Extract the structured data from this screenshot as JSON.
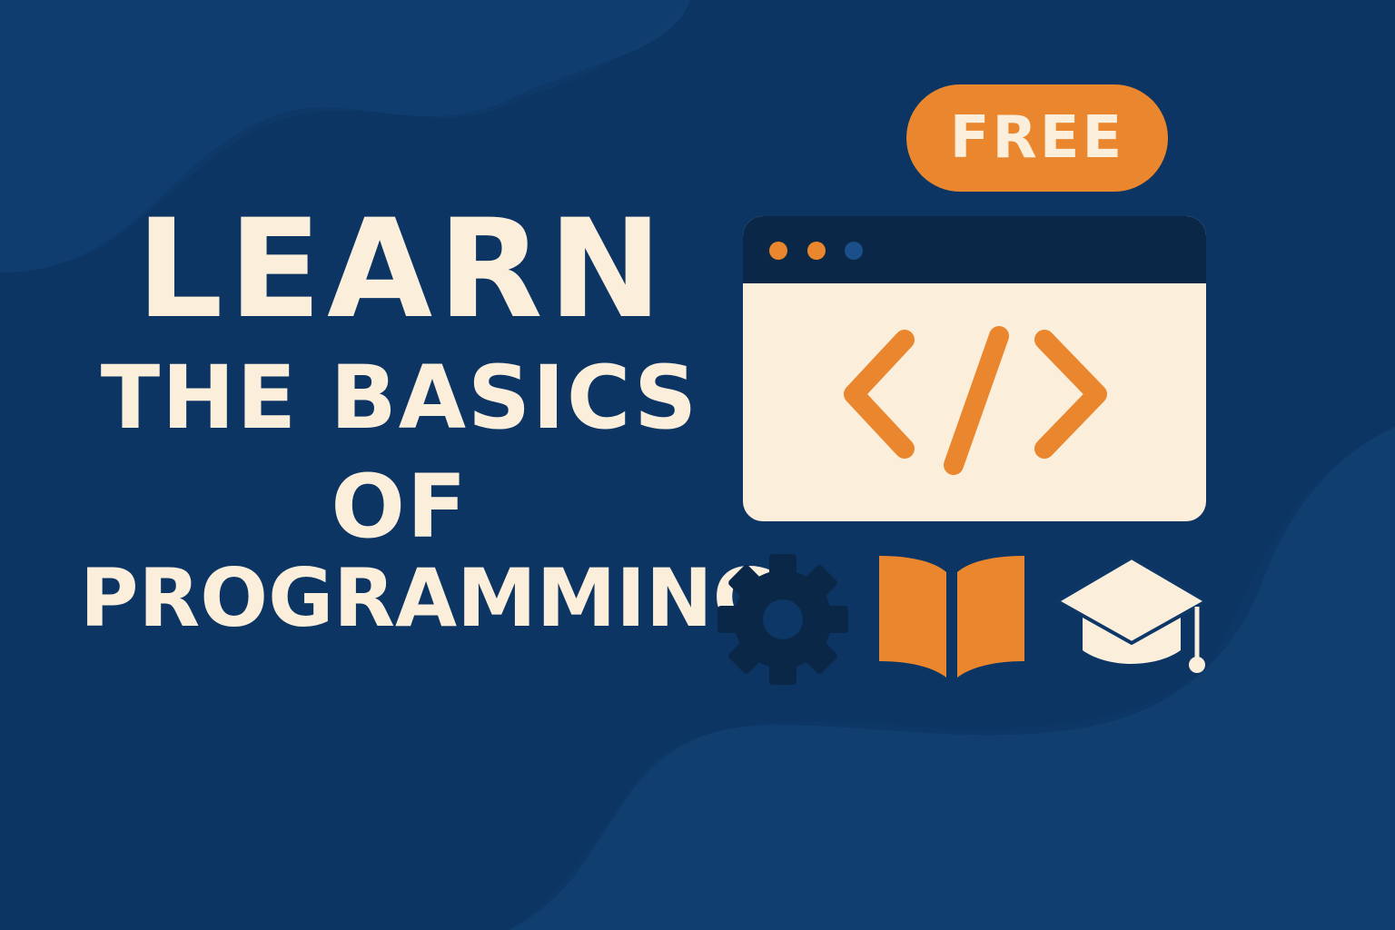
{
  "headline": {
    "line1": "LEARN",
    "line2": "THE BASICS",
    "line3": "OF",
    "line4": "PROGRAMMING"
  },
  "badge": {
    "label": "FREE"
  },
  "icons": {
    "code": "code-brackets-icon",
    "gear": "gear-icon",
    "book": "open-book-icon",
    "graduation": "graduation-cap-icon"
  },
  "colors": {
    "background": "#0d3766",
    "background_light": "#0f3e6f",
    "background_dark": "#0a2d55",
    "cream": "#fbefdc",
    "orange": "#e9862e",
    "navy": "#0a2747"
  }
}
